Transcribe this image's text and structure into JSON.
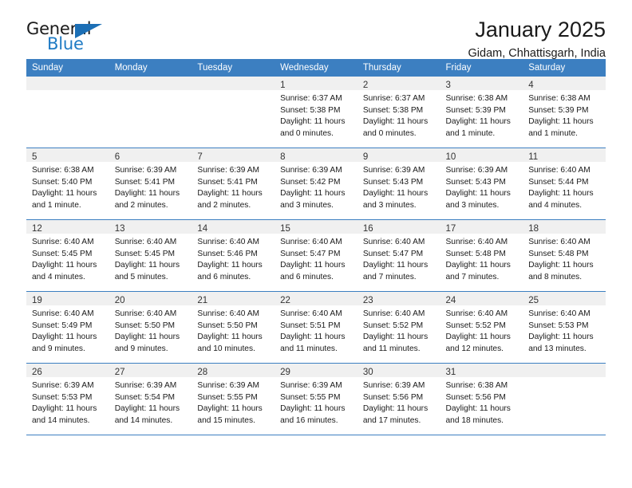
{
  "brand": {
    "name_part1": "General",
    "name_part2": "Blue",
    "triangle_color": "#1c6fb5",
    "blue_color": "#1f7bc4"
  },
  "header": {
    "title": "January 2025",
    "subtitle": "Gidam, Chhattisgarh, India"
  },
  "theme": {
    "header_bg": "#3c7fc1",
    "daynum_bg": "#f0f0f0",
    "divider": "#3c7fc1"
  },
  "weekday_headers": [
    "Sunday",
    "Monday",
    "Tuesday",
    "Wednesday",
    "Thursday",
    "Friday",
    "Saturday"
  ],
  "weeks": [
    [
      {
        "day": "",
        "lines": []
      },
      {
        "day": "",
        "lines": []
      },
      {
        "day": "",
        "lines": []
      },
      {
        "day": "1",
        "lines": [
          "Sunrise: 6:37 AM",
          "Sunset: 5:38 PM",
          "Daylight: 11 hours",
          "and 0 minutes."
        ]
      },
      {
        "day": "2",
        "lines": [
          "Sunrise: 6:37 AM",
          "Sunset: 5:38 PM",
          "Daylight: 11 hours",
          "and 0 minutes."
        ]
      },
      {
        "day": "3",
        "lines": [
          "Sunrise: 6:38 AM",
          "Sunset: 5:39 PM",
          "Daylight: 11 hours",
          "and 1 minute."
        ]
      },
      {
        "day": "4",
        "lines": [
          "Sunrise: 6:38 AM",
          "Sunset: 5:39 PM",
          "Daylight: 11 hours",
          "and 1 minute."
        ]
      }
    ],
    [
      {
        "day": "5",
        "lines": [
          "Sunrise: 6:38 AM",
          "Sunset: 5:40 PM",
          "Daylight: 11 hours",
          "and 1 minute."
        ]
      },
      {
        "day": "6",
        "lines": [
          "Sunrise: 6:39 AM",
          "Sunset: 5:41 PM",
          "Daylight: 11 hours",
          "and 2 minutes."
        ]
      },
      {
        "day": "7",
        "lines": [
          "Sunrise: 6:39 AM",
          "Sunset: 5:41 PM",
          "Daylight: 11 hours",
          "and 2 minutes."
        ]
      },
      {
        "day": "8",
        "lines": [
          "Sunrise: 6:39 AM",
          "Sunset: 5:42 PM",
          "Daylight: 11 hours",
          "and 3 minutes."
        ]
      },
      {
        "day": "9",
        "lines": [
          "Sunrise: 6:39 AM",
          "Sunset: 5:43 PM",
          "Daylight: 11 hours",
          "and 3 minutes."
        ]
      },
      {
        "day": "10",
        "lines": [
          "Sunrise: 6:39 AM",
          "Sunset: 5:43 PM",
          "Daylight: 11 hours",
          "and 3 minutes."
        ]
      },
      {
        "day": "11",
        "lines": [
          "Sunrise: 6:40 AM",
          "Sunset: 5:44 PM",
          "Daylight: 11 hours",
          "and 4 minutes."
        ]
      }
    ],
    [
      {
        "day": "12",
        "lines": [
          "Sunrise: 6:40 AM",
          "Sunset: 5:45 PM",
          "Daylight: 11 hours",
          "and 4 minutes."
        ]
      },
      {
        "day": "13",
        "lines": [
          "Sunrise: 6:40 AM",
          "Sunset: 5:45 PM",
          "Daylight: 11 hours",
          "and 5 minutes."
        ]
      },
      {
        "day": "14",
        "lines": [
          "Sunrise: 6:40 AM",
          "Sunset: 5:46 PM",
          "Daylight: 11 hours",
          "and 6 minutes."
        ]
      },
      {
        "day": "15",
        "lines": [
          "Sunrise: 6:40 AM",
          "Sunset: 5:47 PM",
          "Daylight: 11 hours",
          "and 6 minutes."
        ]
      },
      {
        "day": "16",
        "lines": [
          "Sunrise: 6:40 AM",
          "Sunset: 5:47 PM",
          "Daylight: 11 hours",
          "and 7 minutes."
        ]
      },
      {
        "day": "17",
        "lines": [
          "Sunrise: 6:40 AM",
          "Sunset: 5:48 PM",
          "Daylight: 11 hours",
          "and 7 minutes."
        ]
      },
      {
        "day": "18",
        "lines": [
          "Sunrise: 6:40 AM",
          "Sunset: 5:48 PM",
          "Daylight: 11 hours",
          "and 8 minutes."
        ]
      }
    ],
    [
      {
        "day": "19",
        "lines": [
          "Sunrise: 6:40 AM",
          "Sunset: 5:49 PM",
          "Daylight: 11 hours",
          "and 9 minutes."
        ]
      },
      {
        "day": "20",
        "lines": [
          "Sunrise: 6:40 AM",
          "Sunset: 5:50 PM",
          "Daylight: 11 hours",
          "and 9 minutes."
        ]
      },
      {
        "day": "21",
        "lines": [
          "Sunrise: 6:40 AM",
          "Sunset: 5:50 PM",
          "Daylight: 11 hours",
          "and 10 minutes."
        ]
      },
      {
        "day": "22",
        "lines": [
          "Sunrise: 6:40 AM",
          "Sunset: 5:51 PM",
          "Daylight: 11 hours",
          "and 11 minutes."
        ]
      },
      {
        "day": "23",
        "lines": [
          "Sunrise: 6:40 AM",
          "Sunset: 5:52 PM",
          "Daylight: 11 hours",
          "and 11 minutes."
        ]
      },
      {
        "day": "24",
        "lines": [
          "Sunrise: 6:40 AM",
          "Sunset: 5:52 PM",
          "Daylight: 11 hours",
          "and 12 minutes."
        ]
      },
      {
        "day": "25",
        "lines": [
          "Sunrise: 6:40 AM",
          "Sunset: 5:53 PM",
          "Daylight: 11 hours",
          "and 13 minutes."
        ]
      }
    ],
    [
      {
        "day": "26",
        "lines": [
          "Sunrise: 6:39 AM",
          "Sunset: 5:53 PM",
          "Daylight: 11 hours",
          "and 14 minutes."
        ]
      },
      {
        "day": "27",
        "lines": [
          "Sunrise: 6:39 AM",
          "Sunset: 5:54 PM",
          "Daylight: 11 hours",
          "and 14 minutes."
        ]
      },
      {
        "day": "28",
        "lines": [
          "Sunrise: 6:39 AM",
          "Sunset: 5:55 PM",
          "Daylight: 11 hours",
          "and 15 minutes."
        ]
      },
      {
        "day": "29",
        "lines": [
          "Sunrise: 6:39 AM",
          "Sunset: 5:55 PM",
          "Daylight: 11 hours",
          "and 16 minutes."
        ]
      },
      {
        "day": "30",
        "lines": [
          "Sunrise: 6:39 AM",
          "Sunset: 5:56 PM",
          "Daylight: 11 hours",
          "and 17 minutes."
        ]
      },
      {
        "day": "31",
        "lines": [
          "Sunrise: 6:38 AM",
          "Sunset: 5:56 PM",
          "Daylight: 11 hours",
          "and 18 minutes."
        ]
      },
      {
        "day": "",
        "lines": []
      }
    ]
  ]
}
